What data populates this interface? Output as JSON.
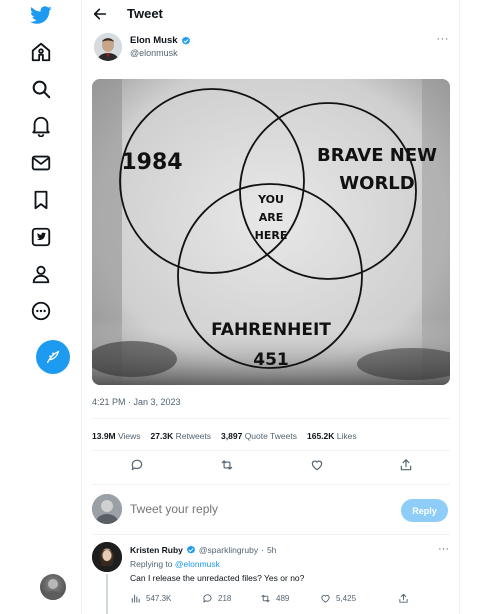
{
  "sidebar": {
    "items": [
      {
        "icon": "twitter-logo-icon"
      },
      {
        "icon": "home-icon"
      },
      {
        "icon": "explore-icon"
      },
      {
        "icon": "notifications-icon"
      },
      {
        "icon": "messages-icon"
      },
      {
        "icon": "bookmarks-icon"
      },
      {
        "icon": "twitter-blue-icon"
      },
      {
        "icon": "profile-icon"
      },
      {
        "icon": "more-circle-icon"
      }
    ],
    "compose_icon": "compose-tweet-icon"
  },
  "header": {
    "title": "Tweet"
  },
  "tweet": {
    "author_name": "Elon Musk",
    "author_handle": "@elonmusk",
    "more": "···",
    "image": {
      "circle_labels": {
        "left": "1984",
        "right_line1": "BRAVE NEW",
        "right_line2": "WORLD",
        "center_line1": "YOU",
        "center_line2": "ARE",
        "center_line3": "HERE",
        "bottom_line1": "FAHRENHEIT",
        "bottom_line2": "451"
      }
    },
    "timestamp": "4:21 PM · Jan 3, 2023",
    "stats": {
      "views_value": "13.9M",
      "views_label": "Views",
      "retweets_value": "27.3K",
      "retweets_label": "Retweets",
      "quotes_value": "3,897",
      "quotes_label": "Quote Tweets",
      "likes_value": "165.2K",
      "likes_label": "Likes"
    }
  },
  "compose_reply": {
    "placeholder": "Tweet your reply",
    "button_label": "Reply"
  },
  "reply": {
    "author_name": "Kristen Ruby",
    "author_handle": "@sparklingruby",
    "separator": "·",
    "time": "5h",
    "more": "···",
    "replying_prefix": "Replying to",
    "replying_to": "@elonmusk",
    "text": "Can I release the unredacted files? Yes or no?",
    "stats": {
      "views": "547.3K",
      "replies": "218",
      "retweets": "489",
      "likes": "5,425"
    }
  },
  "colors": {
    "brand": "#1d9bf0",
    "reply_button_disabled": "#8ecdf8",
    "secondary_text": "#536471"
  }
}
